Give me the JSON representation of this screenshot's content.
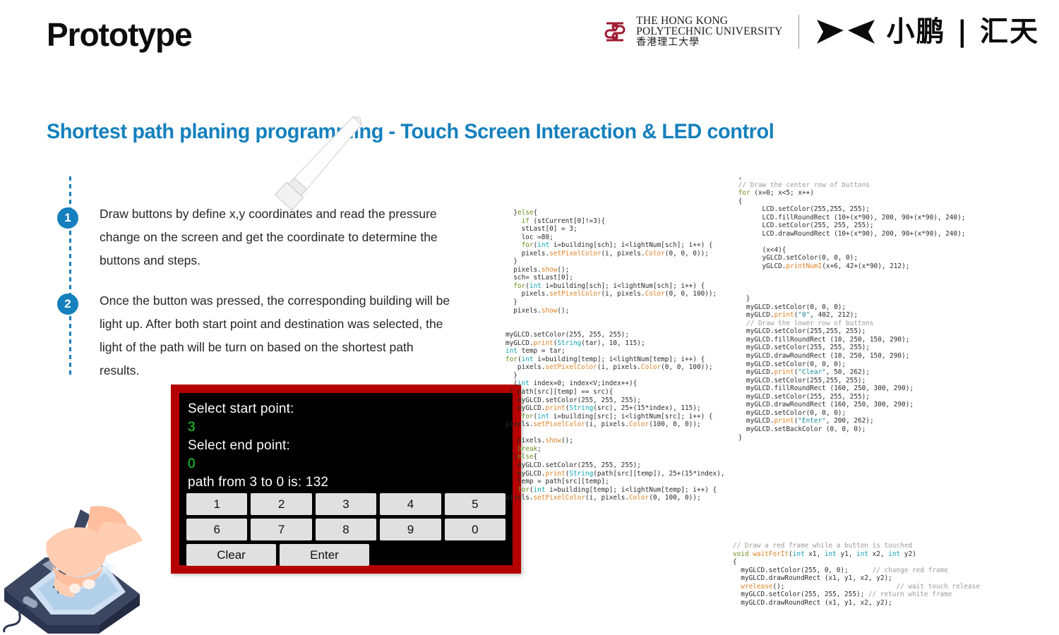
{
  "header": {
    "title": "Prototype",
    "polyu_line1": "THE HONG KONG",
    "polyu_line2": "POLYTECHNIC UNIVERSITY",
    "polyu_line3": "香港理工大學",
    "xpeng_text": "小鹏 | 汇天"
  },
  "subtitle": "Shortest path planing programming -  Touch Screen Interaction & LED control",
  "bullets": [
    {
      "number": "1",
      "text": "Draw buttons by define x,y coordinates and read the pressure change on the screen and get the coordinate to determine the buttons and steps."
    },
    {
      "number": "2",
      "text": "Once the button was pressed, the corresponding building will be light up. After both start point and destination was selected, the light of the path will be turn on based on the shortest path results."
    }
  ],
  "touchscreen": {
    "start_prompt": "Select start point:",
    "start_value": "3",
    "end_prompt": "Select end point:",
    "end_value": "0",
    "path_result": "path from 3 to 0  is: 132",
    "keys_row1": [
      "1",
      "2",
      "3",
      "4",
      "5"
    ],
    "keys_row2": [
      "6",
      "7",
      "8",
      "9",
      "0"
    ],
    "keys_row3": [
      "Clear",
      "Enter"
    ],
    "frame_color": "#b60000",
    "screen_color": "#000000",
    "key_color": "#e0e0e0",
    "value_color": "#16d82a"
  },
  "code_middle": "  }else{\n    if (stCurrent[0]!=3){\n    stLast[0] = 3;\n    loc =80;\n    for(int i=building[sch]; i<lightNum[sch]; i++) {\n    pixels.setPixelColor(i, pixels.Color(0, 0, 0));\n  }\n  pixels.show();\n  sch= stLast[0];\n  for(int i=building[sch]; i<lightNum[sch]; i++) {\n    pixels.setPixelColor(i, pixels.Color(0, 0, 100));\n  }\n  pixels.show();\n\n\nmyGLCD.setColor(255, 255, 255);\nmyGLCD.print(String(tar), 10, 115);\nint temp = tar;\nfor(int i=building[temp]; i<lightNum[temp]; i++) {\n   pixels.setPixelColor(i, pixels.Color(0, 0, 100));\n  }\n  (int index=0; index<V;index++){\n ( path[src][temp] == src){\n   myGLCD.setColor(255, 255, 255);\n   myGLCD.print(String(src), 25+(15*index), 115);\n    for(int i=building[src]; i<lightNum[src]; i++) {\npixels.setPixelColor(i, pixels.Color(100, 0, 0));\n\n   pixels.show();\n   break;\n  }else{\n   myGLCD.setColor(255, 255, 255);\n   myGLCD.print(String(path[src][temp]), 25+(15*index),\n   temp = path[src][temp];\n   for(int i=building[temp]; i<lightNum[temp]; i++) {\npixels.setPixelColor(i, pixels.Color(0, 100, 0));",
  "code_right": " ,\n // Draw the center row of buttons\n for (x=0; x<5; x++)\n {\n       LCD.setColor(255,255, 255);\n       LCD.fillRoundRect (10+(x*90), 200, 90+(x*90), 240);\n       LCD.setColor(255, 255, 255);\n       LCD.drawRoundRect (10+(x*90), 200, 90+(x*90), 240);\n\n       (x<4){\n       yGLCD.setColor(0, 0, 0);\n       yGLCD.printNumI(x+6, 42+(x*90), 212);\n\n\n\n   }\n   myGLCD.setColor(0, 0, 0);\n   myGLCD.print(\"0\", 402, 212);\n   // Draw the lower row of buttons\n   myGLCD.setColor(255,255, 255);\n   myGLCD.fillRoundRect (10, 250, 150, 290);\n   myGLCD.setColor(255, 255, 255);\n   myGLCD.drawRoundRect (10, 250, 150, 290);\n   myGLCD.setColor(0, 0, 0);\n   myGLCD.print(\"Clear\", 50, 262);\n   myGLCD.setColor(255,255, 255);\n   myGLCD.fillRoundRect (160, 250, 300, 290);\n   myGLCD.setColor(255, 255, 255);\n   myGLCD.drawRoundRect (160, 250, 300, 290);\n   myGLCD.setColor(0, 0, 0);\n   myGLCD.print(\"Enter\", 200, 262);\n   myGLCD.setBackColor (0, 0, 0);\n }",
  "code_right_lower": "// Draw a red frame while a button is touched\nvoid waitForIt(int x1, int y1, int x2, int y2)\n{\n  myGLCD.setColor(255, 0, 0);      // change red frame\n  myGLCD.drawRoundRect (x1, y1, x2, y2);\n  wrelease();                            // wait touch release\n  myGLCD.setColor(255, 255, 255); // return white frame\n  myGLCD.drawRoundRect (x1, y1, x2, y2);",
  "colors": {
    "accent_blue": "#1580bd",
    "title_black": "#0d0d0d",
    "polyu_red": "#9e1b32",
    "code_keyword": "#6a8f1f",
    "code_type": "#0aa3b5",
    "code_function": "#e08224",
    "code_comment": "#9b9b9b",
    "code_string": "#1b8a93"
  }
}
